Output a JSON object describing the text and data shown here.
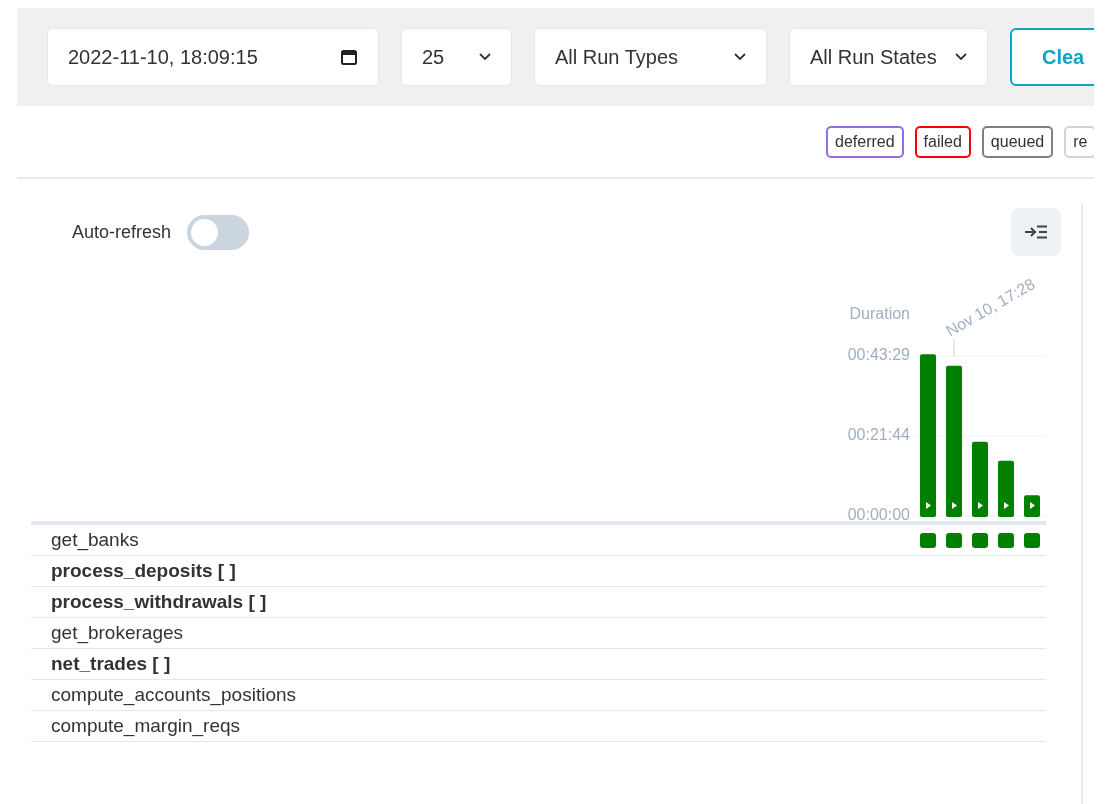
{
  "filters": {
    "date": {
      "value": "2022-11-10, 18:09:15"
    },
    "limit": {
      "value": "25"
    },
    "run_type": {
      "value": "All Run Types"
    },
    "run_state": {
      "value": "All Run States"
    },
    "clear_button": "Clea"
  },
  "legend": [
    {
      "label": "deferred",
      "color": "#9370db"
    },
    {
      "label": "failed",
      "color": "#ff0000"
    },
    {
      "label": "queued",
      "color": "#808080"
    },
    {
      "label": "re",
      "color": "#d3d3d3"
    }
  ],
  "auto_refresh": {
    "label": "Auto-refresh",
    "on": false
  },
  "duration_chart": {
    "run_date_label": "Nov 10, 17:28",
    "chart_data": {
      "type": "bar",
      "ylabel": "Duration",
      "yticks": [
        {
          "value": 0,
          "label": "00:00:00"
        },
        {
          "value": 1304,
          "label": "00:21:44"
        },
        {
          "value": 2609,
          "label": "00:43:29"
        }
      ],
      "ylim": [
        0,
        2660
      ],
      "series": [
        {
          "color": "#008000",
          "values": [
            2640,
            2450,
            1210,
            900,
            340
          ]
        }
      ]
    }
  },
  "tasks": [
    {
      "name": "get_banks",
      "mapped": false,
      "instances": [
        {
          "color": "#008000"
        },
        {
          "color": "#008000"
        },
        {
          "color": "#008000"
        },
        {
          "color": "#008000"
        },
        {
          "color": "#008000"
        }
      ]
    },
    {
      "name": "process_deposits [ ]",
      "mapped": true
    },
    {
      "name": "process_withdrawals [ ]",
      "mapped": true
    },
    {
      "name": "get_brokerages",
      "mapped": false
    },
    {
      "name": "net_trades [ ]",
      "mapped": true
    },
    {
      "name": "compute_accounts_positions",
      "mapped": false
    },
    {
      "name": "compute_margin_reqs",
      "mapped": false
    }
  ]
}
